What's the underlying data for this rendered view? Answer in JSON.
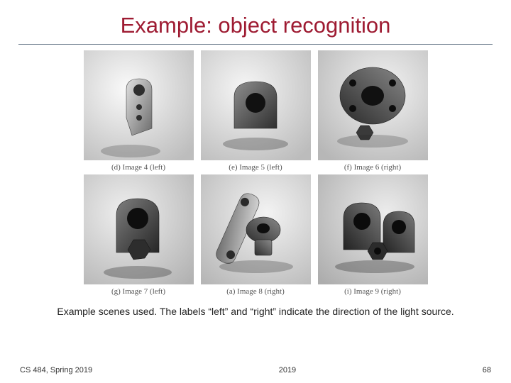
{
  "slide": {
    "title": "Example: object recognition",
    "caption": "Example scenes used. The labels “left” and “right” indicate the direction of the light source."
  },
  "figure": {
    "cells": [
      {
        "label": "(d) Image 4 (left)"
      },
      {
        "label": "(e) Image 5 (left)"
      },
      {
        "label": "(f) Image 6 (right)"
      },
      {
        "label": "(g) Image 7 (left)"
      },
      {
        "label": "(a) Image 8 (right)"
      },
      {
        "label": "(i) Image 9 (right)"
      }
    ]
  },
  "footer": {
    "left": "CS 484, Spring 2019",
    "center": "2019",
    "right": "68"
  }
}
